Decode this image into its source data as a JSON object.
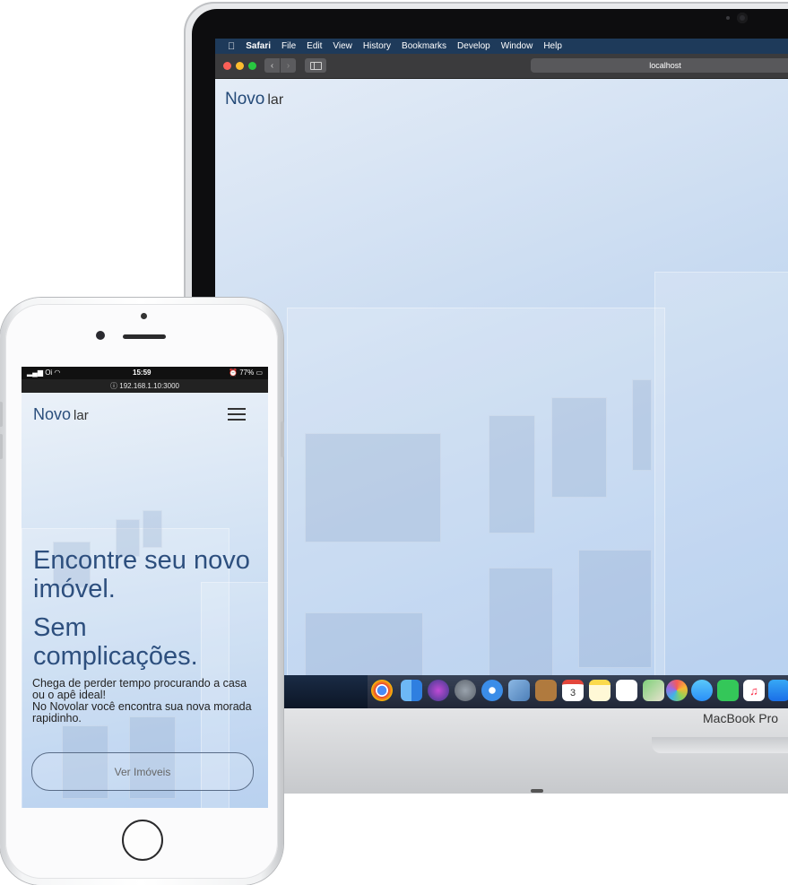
{
  "desktop": {
    "menubar": {
      "apple_glyph": "",
      "app_name": "Safari",
      "items": [
        "File",
        "Edit",
        "View",
        "History",
        "Bookmarks",
        "Develop",
        "Window",
        "Help"
      ]
    },
    "toolbar": {
      "back_glyph": "‹",
      "forward_glyph": "›",
      "address": "localhost"
    },
    "site": {
      "logo_primary": "Novo",
      "logo_secondary": "lar"
    },
    "dock_icons": [
      "chrome-icon",
      "finder-icon",
      "siri-icon",
      "launchpad-icon",
      "safari-icon",
      "mail-icon",
      "contacts-icon",
      "calendar-icon",
      "notes-icon",
      "reminders-icon",
      "maps-icon",
      "photos-icon",
      "messages-icon",
      "facetime-icon",
      "music-icon",
      "app-store-icon"
    ],
    "calendar_day": "3",
    "brand": "MacBook Pro"
  },
  "mobile": {
    "status": {
      "carrier": "Oi",
      "time": "15:59",
      "battery": "77%"
    },
    "url": "192.168.1.10:3000",
    "site": {
      "logo_primary": "Novo",
      "logo_secondary": "lar"
    },
    "hero": {
      "headline_1": "Encontre seu novo imóvel.",
      "headline_2": "Sem complicações.",
      "body_1": "Chega de perder tempo procurando a casa ou o apê ideal!",
      "body_2": "No Novolar você encontra sua nova morada rapidinho.",
      "cta_label": "Ver Imóveis"
    }
  },
  "colors": {
    "brand_blue": "#244a78",
    "menubar": "#1e3a5a"
  }
}
